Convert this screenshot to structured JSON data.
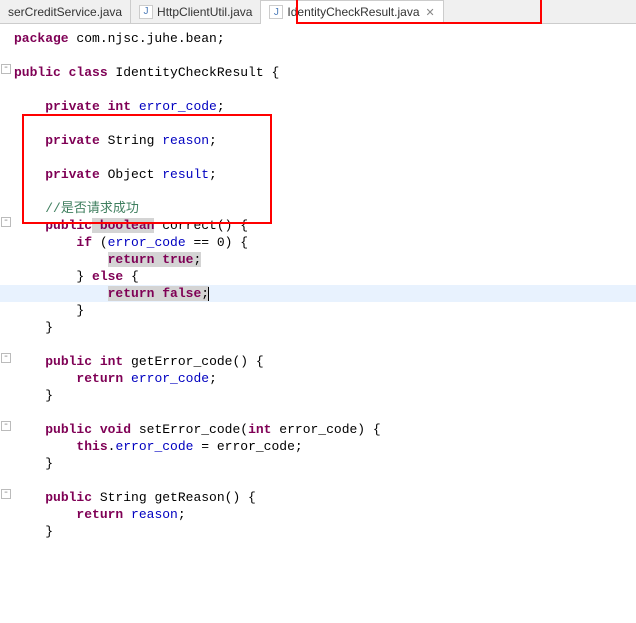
{
  "tabs": {
    "t0": "serCreditService.java",
    "t1": "HttpClientUtil.java",
    "t2": "IdentityCheckResult.java",
    "java_icon": "J",
    "close_icon": "✕"
  },
  "code": {
    "l1_kw": "package",
    "l1_pkg": " com.njsc.juhe.bean;",
    "l3_kw1": "public",
    "l3_kw2": " class",
    "l3_name": " IdentityCheckResult {",
    "l5_kw1": "private",
    "l5_kw2": " int",
    "l5_fld": " error_code",
    "l5_end": ";",
    "l7_kw1": "private",
    "l7_typ": " String",
    "l7_fld": " reason",
    "l7_end": ";",
    "l9_kw1": "private",
    "l9_typ": " Object",
    "l9_fld": " result",
    "l9_end": ";",
    "l11_com": "//是否请求成功",
    "l12_kw1": "public",
    "l12_kw2": " boolean",
    "l12_rest": " correct() {",
    "l13_kw": "if",
    "l13_rest1": " (",
    "l13_fld": "error_code",
    "l13_rest2": " == 0) {",
    "l14_kw": "return",
    "l14_kw2": " true",
    "l14_end": ";",
    "l15_brace": "} ",
    "l15_kw": "else",
    "l15_rest": " {",
    "l16_kw": "return",
    "l16_kw2": " false",
    "l16_end": ";",
    "l17": "}",
    "l18": "}",
    "l20_kw1": "public",
    "l20_kw2": " int",
    "l20_rest": " getError_code() {",
    "l21_kw": "return",
    "l21_fld": " error_code",
    "l21_end": ";",
    "l22": "}",
    "l24_kw1": "public",
    "l24_kw2": " void",
    "l24_rest1": " setError_code(",
    "l24_kw3": "int",
    "l24_rest2": " error_code) {",
    "l25_kw": "this",
    "l25_rest1": ".",
    "l25_fld": "error_code",
    "l25_rest2": " = error_code;",
    "l26": "}",
    "l28_kw1": "public",
    "l28_rest": " String getReason() {",
    "l29_kw": "return",
    "l29_fld": " reason",
    "l29_end": ";",
    "l30": "}"
  }
}
